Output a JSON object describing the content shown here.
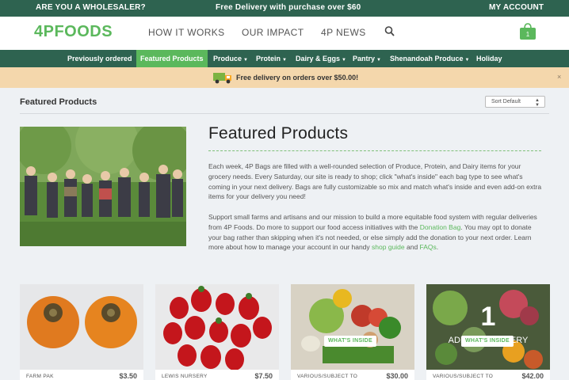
{
  "topbar": {
    "wholesaler": "ARE YOU A WHOLESALER?",
    "free_delivery": "Free Delivery with purchase over $60",
    "account": "MY ACCOUNT"
  },
  "header": {
    "logo": "4PFOODS",
    "nav": [
      "HOW IT WORKS",
      "OUR IMPACT",
      "4P NEWS"
    ],
    "search_icon": "search-icon",
    "cart_icon": "shopping-bag-icon",
    "cart_count": "1"
  },
  "catnav": [
    {
      "label": "Previously ordered",
      "dropdown": false
    },
    {
      "label": "Featured Products",
      "dropdown": false,
      "active": true
    },
    {
      "label": "Produce",
      "dropdown": true
    },
    {
      "label": "Protein",
      "dropdown": true
    },
    {
      "label": "Dairy & Eggs",
      "dropdown": true
    },
    {
      "label": "Pantry",
      "dropdown": true
    },
    {
      "label": "Shenandoah Produce",
      "dropdown": true
    },
    {
      "label": "Holiday",
      "dropdown": false
    }
  ],
  "promo": {
    "text": "Free delivery on orders over $50.00!",
    "close": "×",
    "icon": "delivery-truck-icon"
  },
  "page": {
    "label": "Featured Products",
    "sort": "Sort Default",
    "heading": "Featured Products"
  },
  "intro": {
    "p1": "Each week, 4P Bags are filled with a well-rounded selection of Produce, Protein, and Dairy items for your grocery needs. Every Saturday, our site is ready to shop; click \"what's inside\" each bag type to see what's coming in your next delivery. Bags are fully customizable so mix and match what's inside and even add-on extra items for your delivery you need!",
    "p2_a": "Support small farms and artisans and our mission to build a more equitable food system with regular deliveries from 4P Foods. Do more to support our food access initiatives with the ",
    "p2_link1": "Donation Bag",
    "p2_b": ". You may opt to donate your bag rather than skipping when it's not needed, or else simply add the donation to your next order. Learn more about how to manage your account in our handy ",
    "p2_link2": "shop guide",
    "p2_c": " and ",
    "p2_link3": "FAQs",
    "p2_d": "."
  },
  "products": [
    {
      "source": "FARM PAK",
      "price": "$3.50",
      "whats_inside": ""
    },
    {
      "source": "LEWIS NURSERY",
      "price": "$7.50",
      "whats_inside": ""
    },
    {
      "source": "VARIOUS/SUBJECT TO",
      "price": "$30.00",
      "whats_inside": "WHAT'S INSIDE"
    },
    {
      "source": "VARIOUS/SUBJECT TO",
      "price": "$42.00",
      "whats_inside": "WHAT'S INSIDE",
      "overlay_number": "1",
      "overlay_text": "ADD-ON DELIVERY"
    }
  ],
  "colors": {
    "brand_green": "#5bb85c",
    "dark_green": "#2e6350",
    "promo_bg": "#f4d7ac"
  }
}
